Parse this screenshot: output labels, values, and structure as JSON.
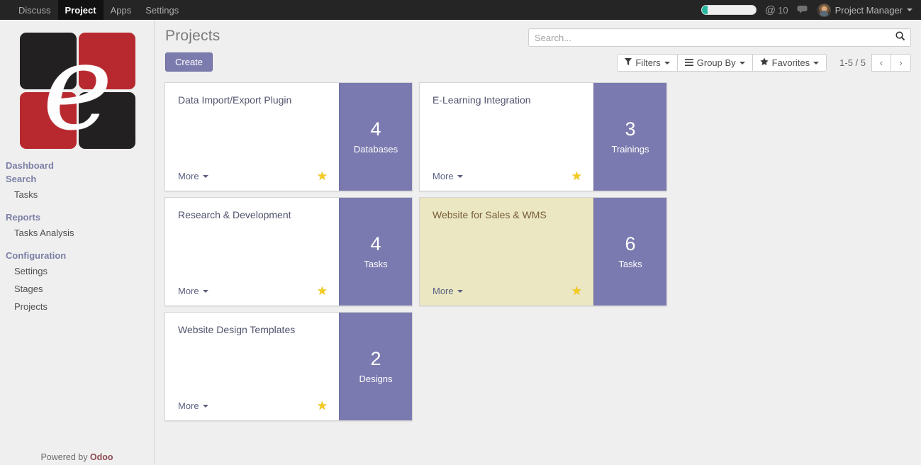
{
  "navbar": {
    "menu_items": [
      {
        "label": "Discuss",
        "active": false
      },
      {
        "label": "Project",
        "active": true
      },
      {
        "label": "Apps",
        "active": false
      },
      {
        "label": "Settings",
        "active": false
      }
    ],
    "progress_percent": 11,
    "mention_count": "10",
    "mention_symbol": "@",
    "chat_icon": "speech-bubble-icon",
    "user_name": "Project Manager"
  },
  "sidebar": {
    "logo": {
      "letter": "e",
      "tile_colors": [
        "#222021",
        "#b8292f",
        "#b8292f",
        "#222021"
      ]
    },
    "sections": [
      {
        "type": "section",
        "label": "Dashboard"
      },
      {
        "type": "section",
        "label": "Search"
      },
      {
        "type": "link",
        "label": "Tasks"
      },
      {
        "type": "section",
        "label": "Reports"
      },
      {
        "type": "link",
        "label": "Tasks Analysis"
      },
      {
        "type": "section",
        "label": "Configuration"
      },
      {
        "type": "link",
        "label": "Settings"
      },
      {
        "type": "link",
        "label": "Stages"
      },
      {
        "type": "link",
        "label": "Projects"
      }
    ],
    "footer": {
      "prefix": "Powered by ",
      "brand": "Odoo"
    }
  },
  "control_panel": {
    "title": "Projects",
    "create_label": "Create",
    "search_placeholder": "Search...",
    "search_value": "",
    "search_icon": "magnifier-icon",
    "filters_label": "Filters",
    "groupby_label": "Group By",
    "favorites_label": "Favorites",
    "pager_label": "1-5 / 5",
    "prev_label": "‹",
    "next_label": "›"
  },
  "kanban": {
    "more_label": "More",
    "star_glyph": "★",
    "cards": [
      {
        "title": "Data Import/Export Plugin",
        "count": "4",
        "count_label": "Databases",
        "highlighted": false,
        "starred": true
      },
      {
        "title": "E-Learning Integration",
        "count": "3",
        "count_label": "Trainings",
        "highlighted": false,
        "starred": true
      },
      {
        "title": "Research & Development",
        "count": "4",
        "count_label": "Tasks",
        "highlighted": false,
        "starred": true
      },
      {
        "title": "Website for Sales & WMS",
        "count": "6",
        "count_label": "Tasks",
        "highlighted": true,
        "starred": true
      },
      {
        "title": "Website Design Templates",
        "count": "2",
        "count_label": "Designs",
        "highlighted": false,
        "starred": true
      }
    ]
  },
  "colors": {
    "navbar_bg": "#252525",
    "accent_purple": "#7c7bad",
    "card_purple": "#7a7ab0",
    "highlight_beige": "#eae7c2",
    "star_gold": "#f4cb20",
    "progress_green": "#27b7a0",
    "brand_red": "#b8292f"
  }
}
